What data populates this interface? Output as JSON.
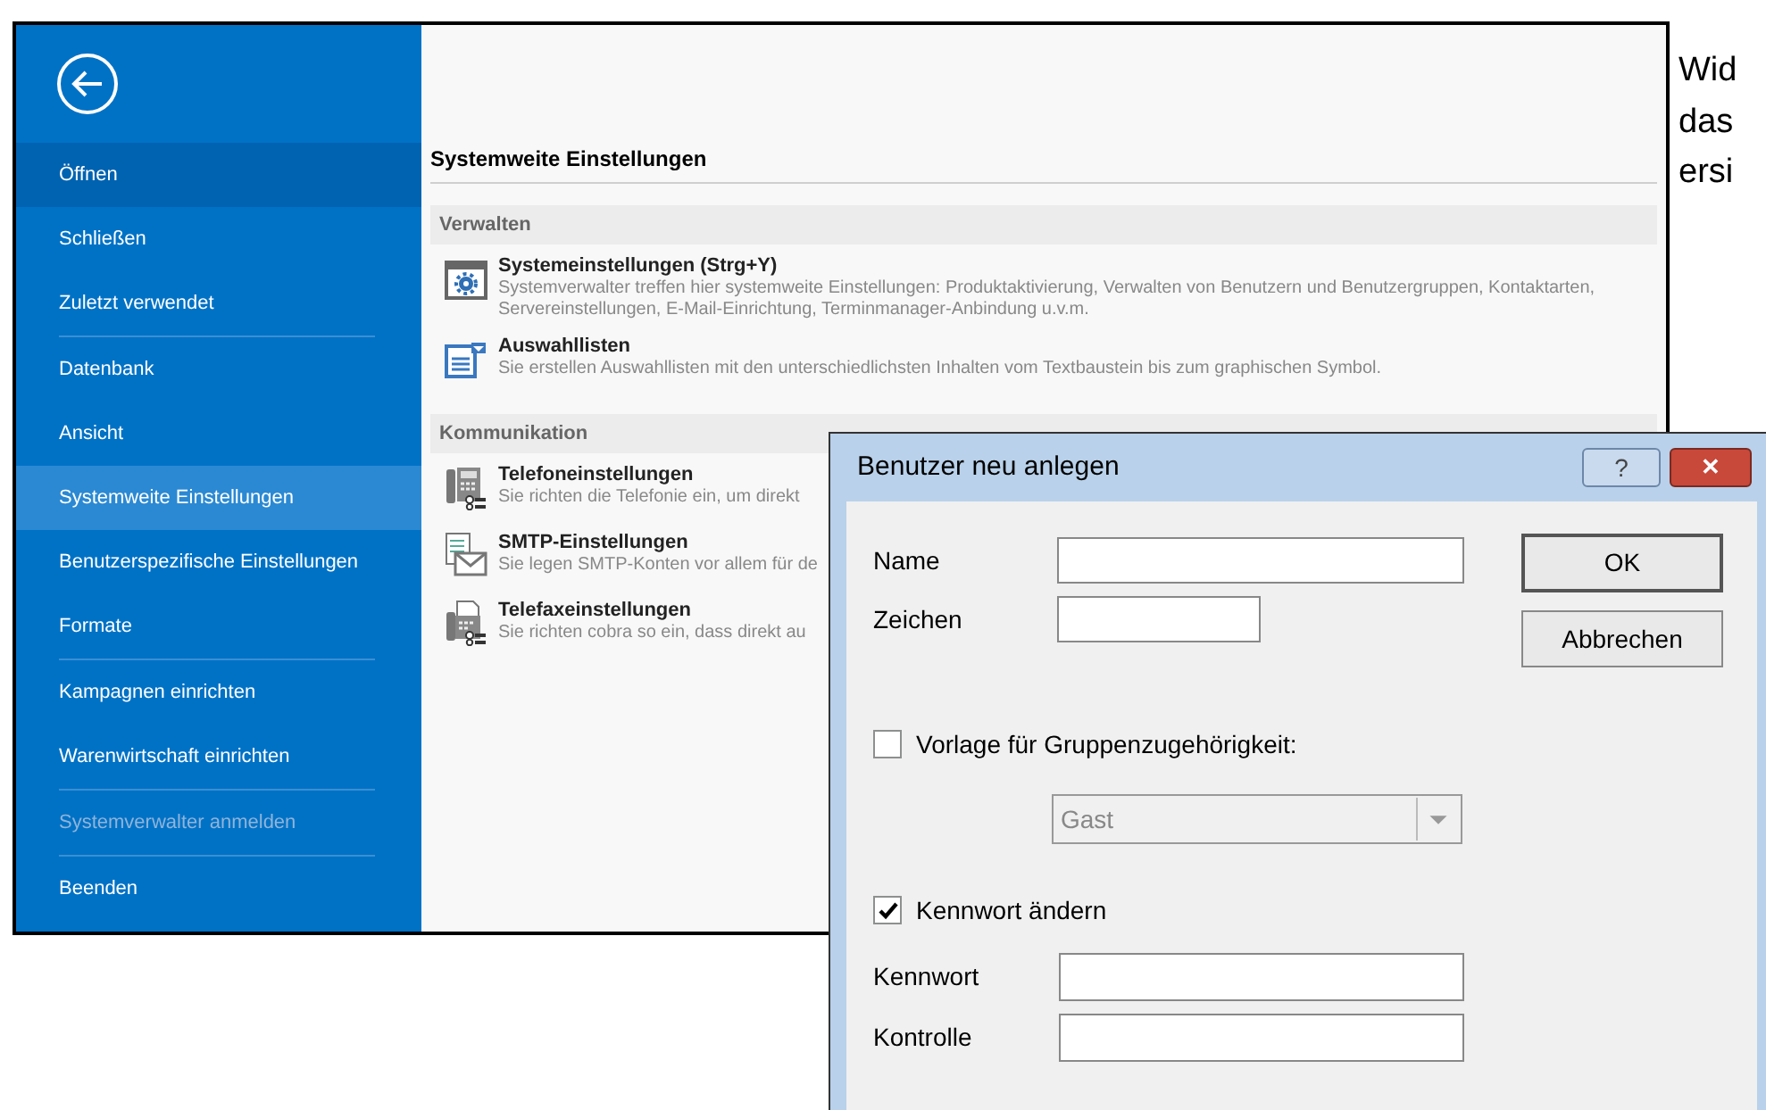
{
  "backstage": {
    "nav": [
      {
        "label": "Öffnen",
        "selected": false,
        "hovered": true,
        "disabled": false,
        "separator_after": false
      },
      {
        "label": "Schließen",
        "selected": false,
        "hovered": false,
        "disabled": false,
        "separator_after": false
      },
      {
        "label": "Zuletzt verwendet",
        "selected": false,
        "hovered": false,
        "disabled": false,
        "separator_after": true
      },
      {
        "label": "Datenbank",
        "selected": false,
        "hovered": false,
        "disabled": false,
        "separator_after": false
      },
      {
        "label": "Ansicht",
        "selected": false,
        "hovered": false,
        "disabled": false,
        "separator_after": false
      },
      {
        "label": "Systemweite Einstellungen",
        "selected": true,
        "hovered": false,
        "disabled": false,
        "separator_after": false
      },
      {
        "label": "Benutzerspezifische Einstellungen",
        "selected": false,
        "hovered": false,
        "disabled": false,
        "separator_after": false
      },
      {
        "label": "Formate",
        "selected": false,
        "hovered": false,
        "disabled": false,
        "separator_after": true
      },
      {
        "label": "Kampagnen einrichten",
        "selected": false,
        "hovered": false,
        "disabled": false,
        "separator_after": false
      },
      {
        "label": "Warenwirtschaft einrichten",
        "selected": false,
        "hovered": false,
        "disabled": false,
        "separator_after": true
      },
      {
        "label": "Systemverwalter anmelden",
        "selected": false,
        "hovered": false,
        "disabled": true,
        "separator_after": true
      },
      {
        "label": "Beenden",
        "selected": false,
        "hovered": false,
        "disabled": false,
        "separator_after": false
      }
    ],
    "heading": "Systemweite Einstellungen",
    "sections": [
      {
        "title": "Verwalten",
        "items": [
          {
            "kind": "settings",
            "title": "Systemeinstellungen (Strg+Y)",
            "description": "Systemverwalter treffen hier systemweite Einstellungen: Produktaktivierung, Verwalten von Benutzern und Benutzergruppen, Kontaktarten, Servereinstellungen, E-Mail-Einrichtung, Terminmanager-Anbindung u.v.m."
          },
          {
            "kind": "list",
            "title": "Auswahllisten",
            "description": "Sie erstellen Auswahllisten mit den unterschiedlichsten Inhalten vom Textbaustein bis zum graphischen Symbol."
          }
        ]
      },
      {
        "title": "Kommunikation",
        "items": [
          {
            "kind": "phone",
            "title": "Telefoneinstellungen",
            "description": "Sie richten die Telefonie ein, um direkt"
          },
          {
            "kind": "mail",
            "title": "SMTP-Einstellungen",
            "description": "Sie legen SMTP-Konten vor allem für de"
          },
          {
            "kind": "fax",
            "title": "Telefaxeinstellungen",
            "description": "Sie richten cobra so ein, dass direkt au"
          }
        ]
      }
    ]
  },
  "dialog": {
    "title": "Benutzer neu anlegen",
    "help": "?",
    "close": "✕",
    "name_label": "Name",
    "sign_label": "Zeichen",
    "ok": "OK",
    "cancel": "Abbrechen",
    "template_checkbox": {
      "label": "Vorlage für Gruppenzugehörigkeit:",
      "checked": false
    },
    "group_select": {
      "value": "Gast",
      "disabled": true
    },
    "password_checkbox": {
      "label": "Kennwort ändern",
      "checked": true
    },
    "password_label": "Kennwort",
    "confirm_label": "Kontrolle"
  },
  "document_text": [
    "Wid",
    "das",
    "ersi"
  ]
}
